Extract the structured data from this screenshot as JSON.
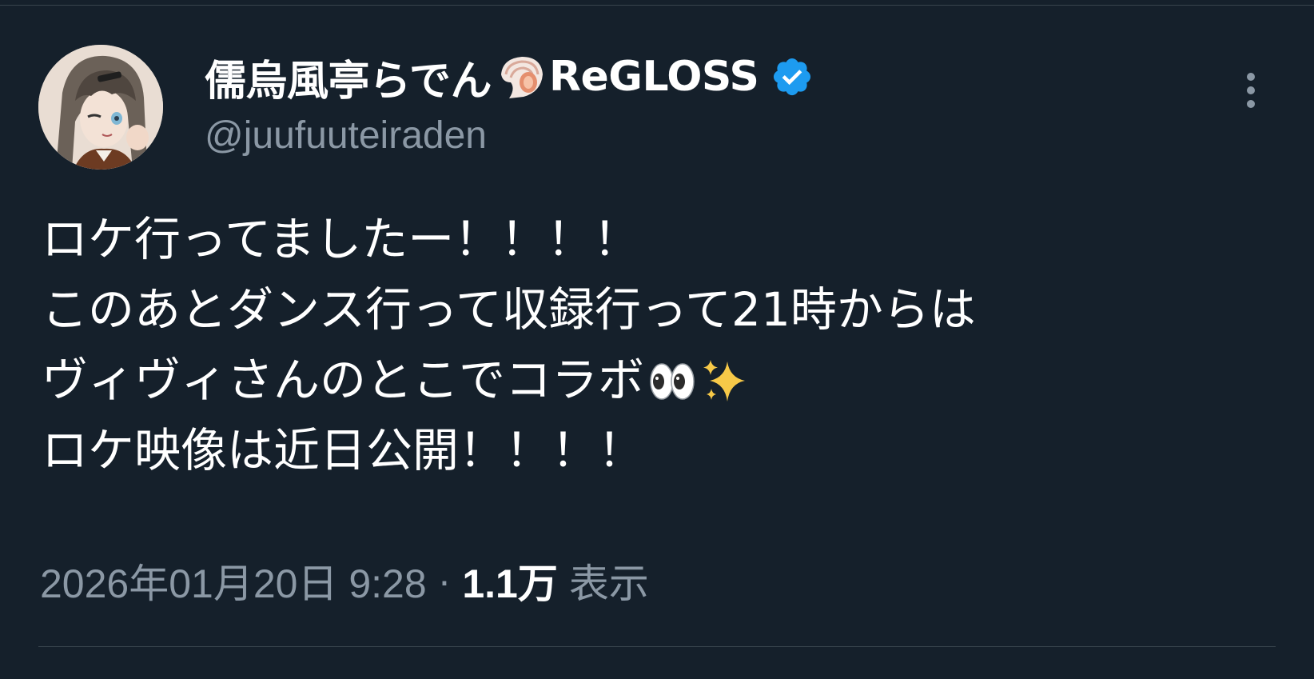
{
  "author": {
    "display_name": "儒烏風亭らでん",
    "name_suffix": "ReGLOSS",
    "handle": "@juufuuteiraden",
    "name_emoji": "spiral-shell-icon",
    "verified": true,
    "verified_color": "#1d9bf0"
  },
  "tweet": {
    "lines": [
      "ロケ行ってましたー！！！！",
      "このあとダンス行って収録行って21時からは",
      "ヴィヴィさんのとこでコラボ",
      "ロケ映像は近日公開！！！！"
    ],
    "line3_emojis": [
      "eyes-icon",
      "sparkles-icon"
    ]
  },
  "meta": {
    "timestamp": "2026年01月20日 9:28",
    "separator": "·",
    "views_count": "1.1万",
    "views_label": "表示"
  },
  "colors": {
    "background": "#15202b",
    "secondary_text": "#8b98a5",
    "border": "#38444d"
  }
}
